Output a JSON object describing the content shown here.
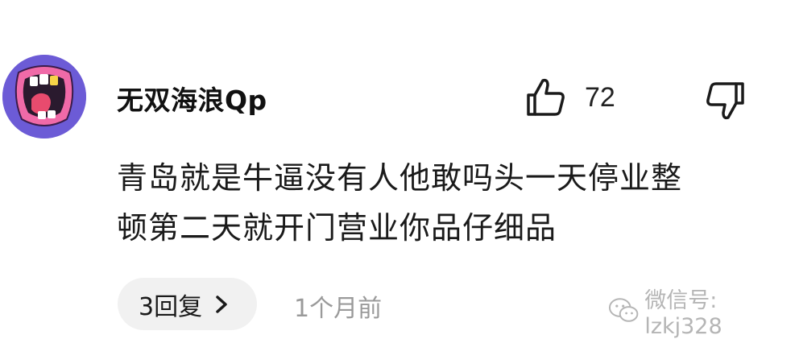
{
  "comment": {
    "username": "无双海浪Qp",
    "like_count": "72",
    "text_lines": [
      "青岛就是牛逼没有人他敢吗头一天停业整",
      "顿第二天就开门营业你品仔细品"
    ],
    "replies_label": "3回复",
    "timestamp": "1个月前"
  },
  "watermark": {
    "text": "微信号: lzkj328"
  },
  "icons": {
    "avatar": "screaming-mouth-avatar",
    "like": "thumbs-up-icon",
    "dislike": "thumbs-down-icon",
    "replies": "chevron-right-icon",
    "watermark": "wechat-icon"
  },
  "colors": {
    "avatar_bg": "#6c5bd6",
    "avatar_lips": "#f06aa8",
    "text": "#1a1a1a",
    "muted": "#9a9a9a",
    "pill_bg": "#f1f1f1"
  }
}
